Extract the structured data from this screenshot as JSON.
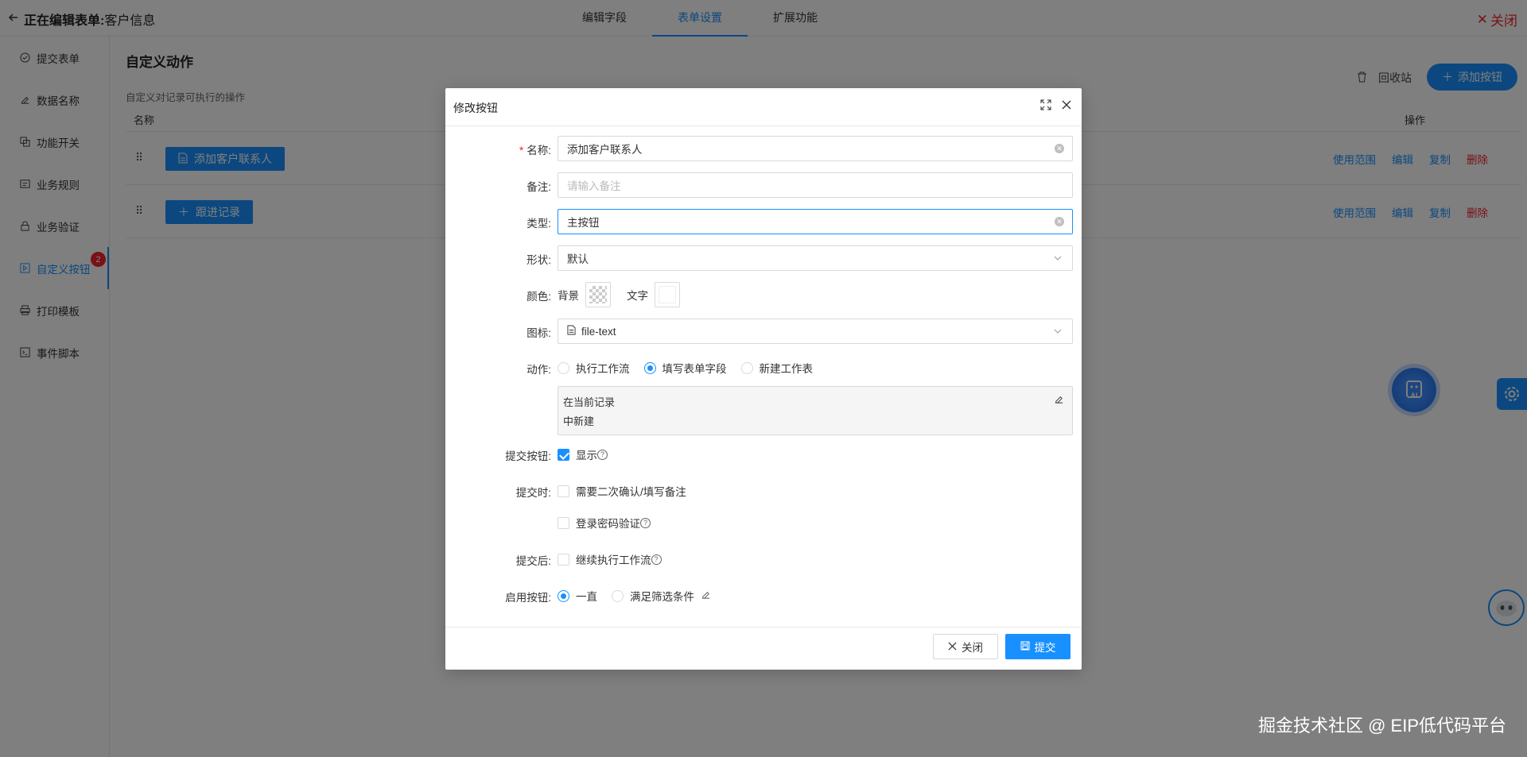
{
  "header": {
    "title": "正在编辑表单:",
    "form_name": "客户信息",
    "tabs": [
      {
        "label": "编辑字段"
      },
      {
        "label": "表单设置"
      },
      {
        "label": "扩展功能"
      }
    ],
    "close_label": "关闭"
  },
  "sidebar": {
    "items": [
      {
        "label": "提交表单",
        "icon": "check-circle-icon"
      },
      {
        "label": "数据名称",
        "icon": "edit-icon"
      },
      {
        "label": "功能开关",
        "icon": "switch-icon"
      },
      {
        "label": "业务规则",
        "icon": "rules-icon"
      },
      {
        "label": "业务验证",
        "icon": "lock-icon"
      },
      {
        "label": "自定义按钮",
        "icon": "custom-button-icon",
        "badge": "2"
      },
      {
        "label": "打印模板",
        "icon": "printer-icon"
      },
      {
        "label": "事件脚本",
        "icon": "terminal-icon"
      }
    ]
  },
  "main": {
    "title": "自定义动作",
    "description": "自定义对记录可执行的操作",
    "recycle_label": "回收站",
    "add_button_label": "添加按钮",
    "columns": {
      "name": "名称",
      "ops": "操作"
    },
    "rows": [
      {
        "button_label": "添加客户联系人",
        "ops": [
          "使用范围",
          "编辑",
          "复制",
          "删除"
        ]
      },
      {
        "button_label": "跟进记录",
        "ops": [
          "使用范围",
          "编辑",
          "复制",
          "删除"
        ]
      }
    ]
  },
  "modal": {
    "title": "修改按钮",
    "name_label": "名称:",
    "name_value": "添加客户联系人",
    "remark_label": "备注:",
    "remark_placeholder": "请输入备注",
    "type_label": "类型:",
    "type_value": "主按钮",
    "shape_label": "形状:",
    "shape_value": "默认",
    "color_label": "颜色:",
    "color_bg_label": "背景",
    "color_text_label": "文字",
    "icon_label": "图标:",
    "icon_value": "file-text",
    "action_label": "动作:",
    "action_options": [
      {
        "label": "执行工作流",
        "selected": false
      },
      {
        "label": "填写表单字段",
        "selected": true
      },
      {
        "label": "新建工作表",
        "selected": false
      }
    ],
    "action_desc_line1": "在当前记录",
    "action_desc_line2": "中新建",
    "submit_btn_label": "提交按钮:",
    "submit_btn_show": "显示",
    "on_submit_label": "提交时:",
    "on_submit_confirm": "需要二次确认/填写备注",
    "on_submit_password": "登录密码验证",
    "after_submit_label": "提交后:",
    "after_submit_workflow": "继续执行工作流",
    "enable_label": "启用按钮:",
    "enable_options": [
      {
        "label": "一直",
        "selected": true
      },
      {
        "label": "满足筛选条件",
        "selected": false
      }
    ],
    "close_btn": "关闭",
    "submit_btn": "提交"
  },
  "floating": {
    "ai_label": "AI"
  },
  "footer": {
    "watermark": "掘金技术社区 @ EIP低代码平台"
  },
  "colors": {
    "primary": "#1890ff",
    "danger": "#f5222d"
  }
}
